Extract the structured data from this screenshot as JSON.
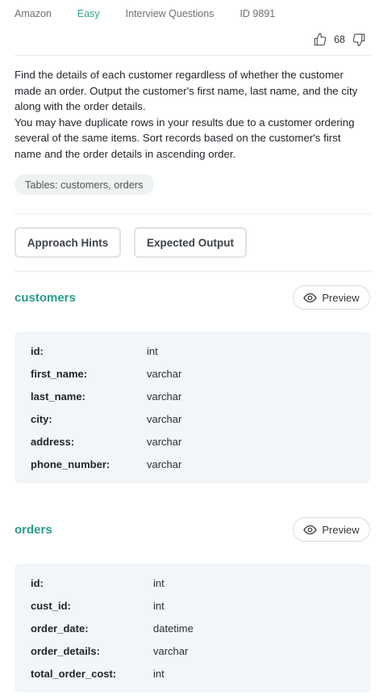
{
  "meta": {
    "company": "Amazon",
    "difficulty": "Easy",
    "category": "Interview Questions",
    "id": "ID 9891"
  },
  "votes": {
    "count": "68",
    "upvote_icon": "thumbs-up-icon",
    "downvote_icon": "thumbs-down-icon"
  },
  "description": {
    "line1": "Find the details of each customer regardless of whether the customer made an order. Output the customer's first name, last name, and the city along with the order details.",
    "line2": "You may have duplicate rows in your results due to a customer ordering several of the same items. Sort records based on the customer's first name and the order details in ascending order."
  },
  "tables_label": "Tables: customers, orders",
  "buttons": {
    "hints": "Approach Hints",
    "expected": "Expected Output"
  },
  "preview_label": "Preview",
  "colors": {
    "accent": "#2b9a8b",
    "easy": "#3aa395",
    "schema_bg": "#f3f6f9"
  },
  "schemas": [
    {
      "name": "customers",
      "columns": [
        {
          "col": "id:",
          "type": "int"
        },
        {
          "col": "first_name:",
          "type": "varchar"
        },
        {
          "col": "last_name:",
          "type": "varchar"
        },
        {
          "col": "city:",
          "type": "varchar"
        },
        {
          "col": "address:",
          "type": "varchar"
        },
        {
          "col": "phone_number:",
          "type": "varchar"
        }
      ]
    },
    {
      "name": "orders",
      "columns": [
        {
          "col": "id:",
          "type": "int"
        },
        {
          "col": "cust_id:",
          "type": "int"
        },
        {
          "col": "order_date:",
          "type": "datetime"
        },
        {
          "col": "order_details:",
          "type": "varchar"
        },
        {
          "col": "total_order_cost:",
          "type": "int"
        }
      ]
    }
  ]
}
